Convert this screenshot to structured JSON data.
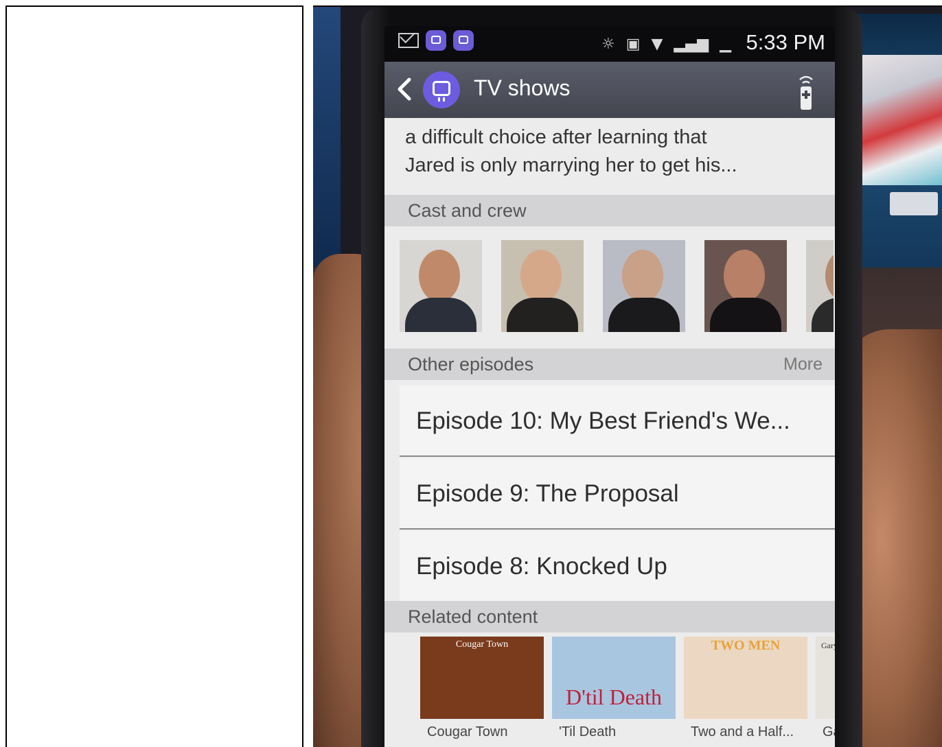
{
  "status_bar": {
    "time": "5:33 PM"
  },
  "action_bar": {
    "title": "TV shows"
  },
  "synopsis": {
    "lines": [
      "a difficult choice after learning that",
      "Jared is only marrying her to get his..."
    ]
  },
  "sections": {
    "cast": "Cast and crew",
    "other_episodes": "Other episodes",
    "more": "More",
    "related": "Related content"
  },
  "episodes": [
    {
      "label": "Episode  10: My Best Friend's We..."
    },
    {
      "label": "Episode  9: The Proposal"
    },
    {
      "label": "Episode  8: Knocked Up"
    }
  ],
  "related": [
    {
      "label": "Cougar Town",
      "thumb_text": "Cougar Town",
      "color": "#7a3a1c"
    },
    {
      "label": "'Til Death",
      "thumb_text": "D'til Death",
      "color": "#a8c6e0"
    },
    {
      "label": "Two and a Half...",
      "thumb_text": "TWO MEN",
      "color": "#ecd8c2"
    },
    {
      "label": "Ga",
      "thumb_text": "Gary",
      "color": "#e6e2dc"
    }
  ],
  "cast_colors": [
    {
      "face": "#c08a6a",
      "body": "#2a2f3a",
      "bg": "#d8d6d2"
    },
    {
      "face": "#d6a88a",
      "body": "#22211f",
      "bg": "#c7bfb0"
    },
    {
      "face": "#c9a088",
      "body": "#1a1a1c",
      "bg": "#b9bcc4"
    },
    {
      "face": "#b88066",
      "body": "#141214",
      "bg": "#6a5450"
    },
    {
      "face": "#b48a70",
      "body": "#2a2a2a",
      "bg": "#d0cdc8"
    }
  ]
}
